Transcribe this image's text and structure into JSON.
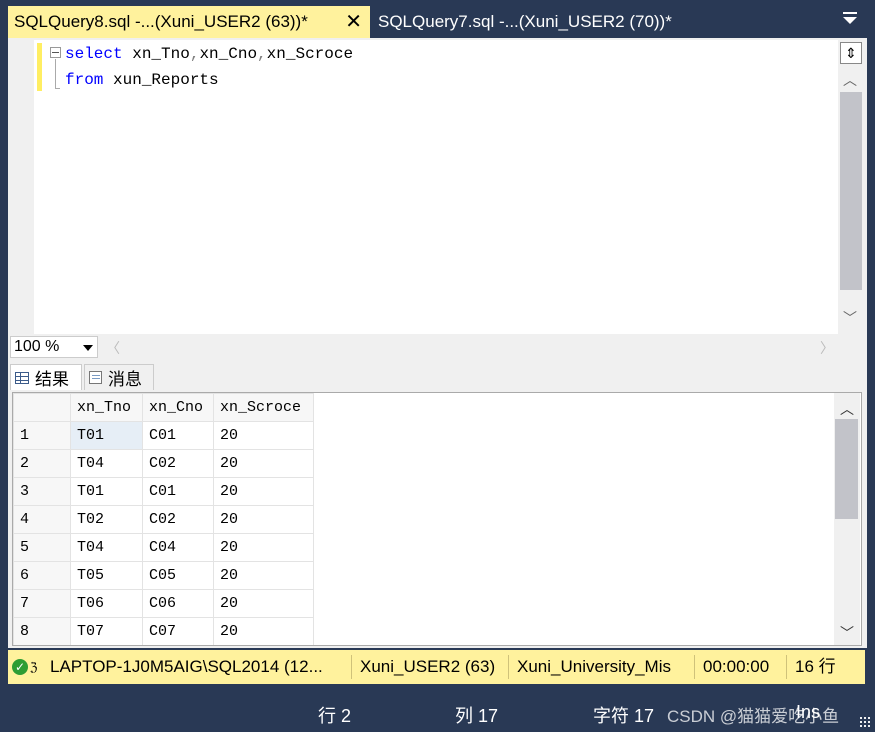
{
  "tabs": [
    {
      "label": "SQLQuery8.sql -...(Xuni_USER2 (63))*",
      "active": true,
      "close_glyph": "✕"
    },
    {
      "label": "SQLQuery7.sql -...(Xuni_USER2 (70))*",
      "active": false
    }
  ],
  "editor": {
    "line1": {
      "kw": "select",
      "c1": "xn_Tno",
      "sep1": ",",
      "c2": "xn_Cno",
      "sep2": ",",
      "c3": "xn_Scroce"
    },
    "line2": {
      "kw": "from",
      "table": "xun_Reports"
    }
  },
  "zoom": {
    "value": "100 %"
  },
  "results_tabs": {
    "results": "结果",
    "messages": "消息"
  },
  "grid": {
    "columns": [
      "xn_Tno",
      "xn_Cno",
      "xn_Scroce"
    ],
    "rows": [
      {
        "n": "1",
        "tno": "T01",
        "cno": "C01",
        "score": "20"
      },
      {
        "n": "2",
        "tno": "T04",
        "cno": "C02",
        "score": "20"
      },
      {
        "n": "3",
        "tno": "T01",
        "cno": "C01",
        "score": "20"
      },
      {
        "n": "4",
        "tno": "T02",
        "cno": "C02",
        "score": "20"
      },
      {
        "n": "5",
        "tno": "T04",
        "cno": "C04",
        "score": "20"
      },
      {
        "n": "6",
        "tno": "T05",
        "cno": "C05",
        "score": "20"
      },
      {
        "n": "7",
        "tno": "T06",
        "cno": "C06",
        "score": "20"
      },
      {
        "n": "8",
        "tno": "T07",
        "cno": "C07",
        "score": "20"
      }
    ]
  },
  "statusbar": {
    "server": "LAPTOP-1J0M5AIG\\SQL2014 (12...",
    "user": "Xuni_USER2 (63)",
    "database": "Xuni_University_Mis",
    "elapsed": "00:00:00",
    "rows": "16 行"
  },
  "app_status": {
    "line": "行 2",
    "col": "列 17",
    "char": "字符 17",
    "mode": "Ins"
  },
  "watermark": "CSDN @猫猫爱吃小鱼",
  "colors": {
    "tab_active": "#FFF29D",
    "chrome": "#293955",
    "keyword": "#0000FF",
    "status_ok": "#2E9D34"
  }
}
